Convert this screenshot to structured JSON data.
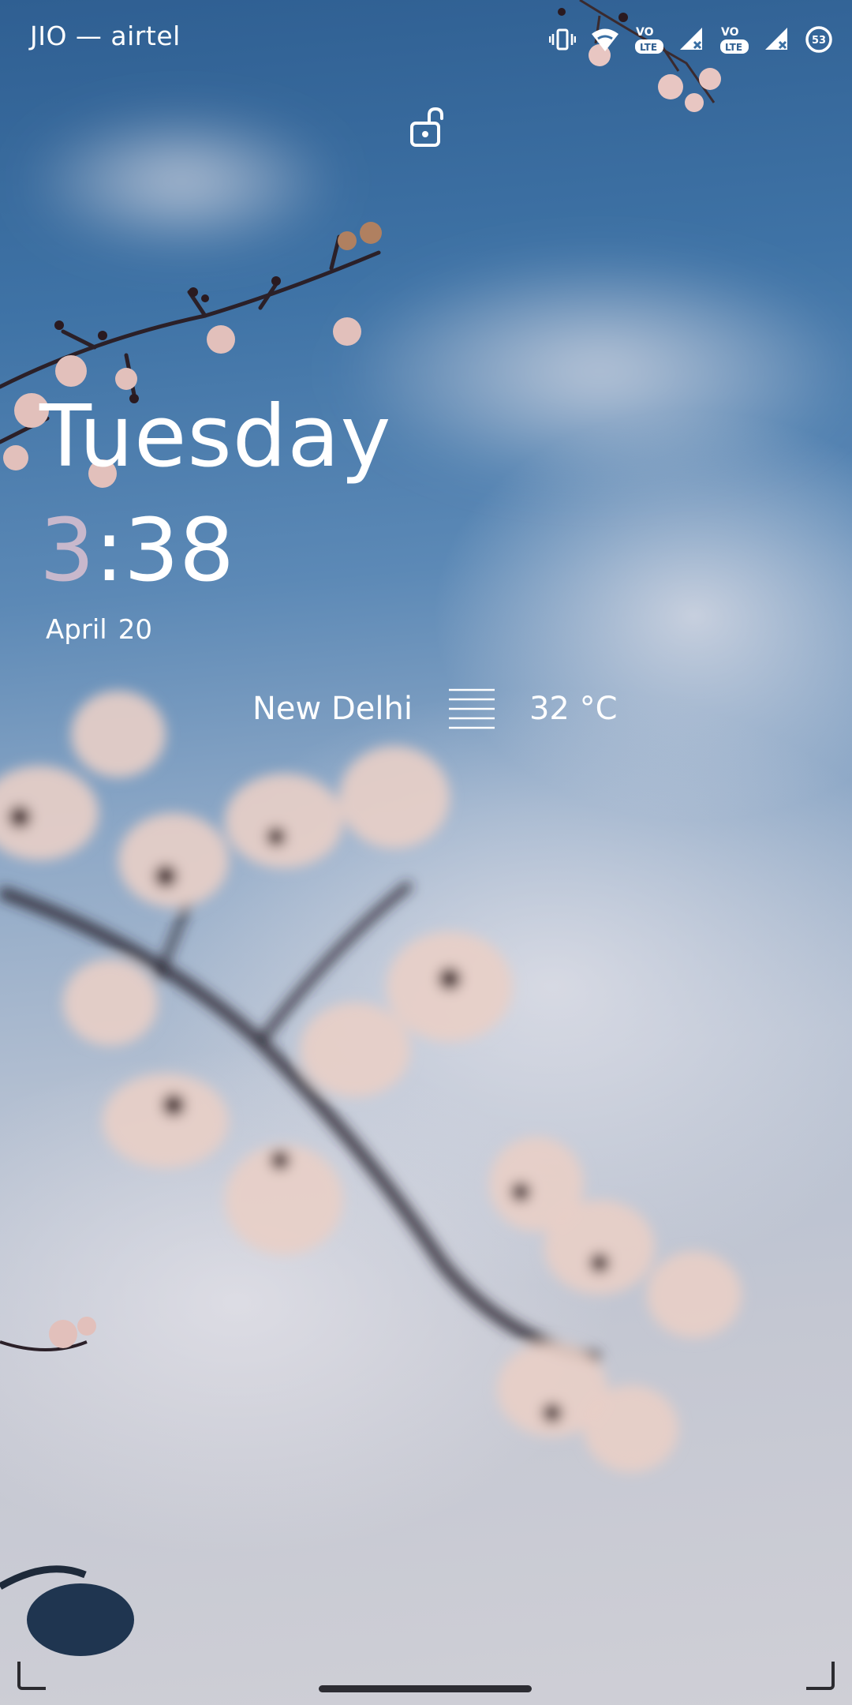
{
  "statusbar": {
    "carrier": "JIO — airtel",
    "icons": [
      "vibrate-icon",
      "wifi-calling-icon",
      "volte-lte-icon",
      "signal-no-service-icon",
      "volte-lte-icon",
      "signal-no-service-icon",
      "battery-icon"
    ],
    "vo_label_1": "VO",
    "lte_label_1": "LTE",
    "vo_label_2": "VO",
    "lte_label_2": "LTE",
    "battery": "53"
  },
  "lockscreen": {
    "lock_icon": "unlock-icon",
    "day": "Tuesday",
    "time_hour": "3",
    "time_rest": ":38",
    "date_month": "April",
    "date_day": "20"
  },
  "weather": {
    "city": "New Delhi",
    "icon": "fog-icon",
    "temperature": "32 °C"
  },
  "colors": {
    "text": "#ffffff",
    "hour_accent": "#c8b8cc",
    "sky_top": "#2f5f92",
    "sky_bottom": "#cfcfd6"
  }
}
